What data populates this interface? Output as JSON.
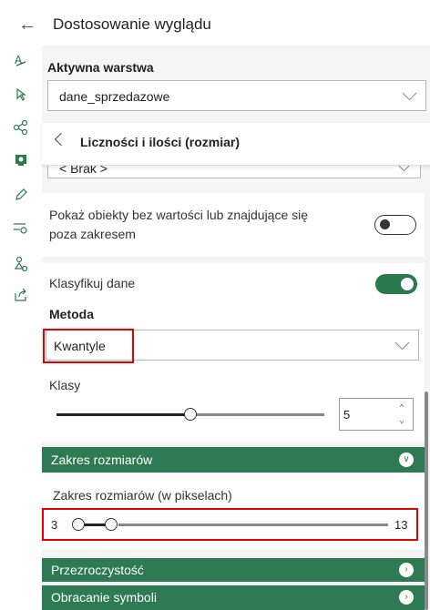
{
  "header": {
    "title": "Dostosowanie wyglądu"
  },
  "active_layer": {
    "label": "Aktywna warstwa",
    "value": "dane_sprzedazowe"
  },
  "sub_panel": {
    "title": "Liczności i ilości (rozmiar)"
  },
  "partial_dropdown": {
    "value": "< Brak >"
  },
  "show_nodata": {
    "label_line1": "Pokaż obiekty bez wartości lub znajdujące się",
    "label_line2": "poza zakresem",
    "enabled": false
  },
  "classify": {
    "label": "Klasyfikuj dane",
    "enabled": true
  },
  "method": {
    "label": "Metoda",
    "value": "Kwantyle"
  },
  "classes": {
    "label": "Klasy",
    "value": "5",
    "slider_fraction": 0.5
  },
  "size_range_section": {
    "title": "Zakres rozmiarów"
  },
  "size_range": {
    "label": "Zakres rozmiarów (w pikselach)",
    "min": "3",
    "max": "13"
  },
  "transparency_section": {
    "title": "Przezroczystość"
  },
  "rotation_section": {
    "title": "Obracanie symboli"
  },
  "icons": {
    "back": "back-arrow-icon",
    "chevron_left": "chevron-left-icon"
  },
  "colors": {
    "accent": "#2e7a52",
    "highlight": "#e00000"
  }
}
